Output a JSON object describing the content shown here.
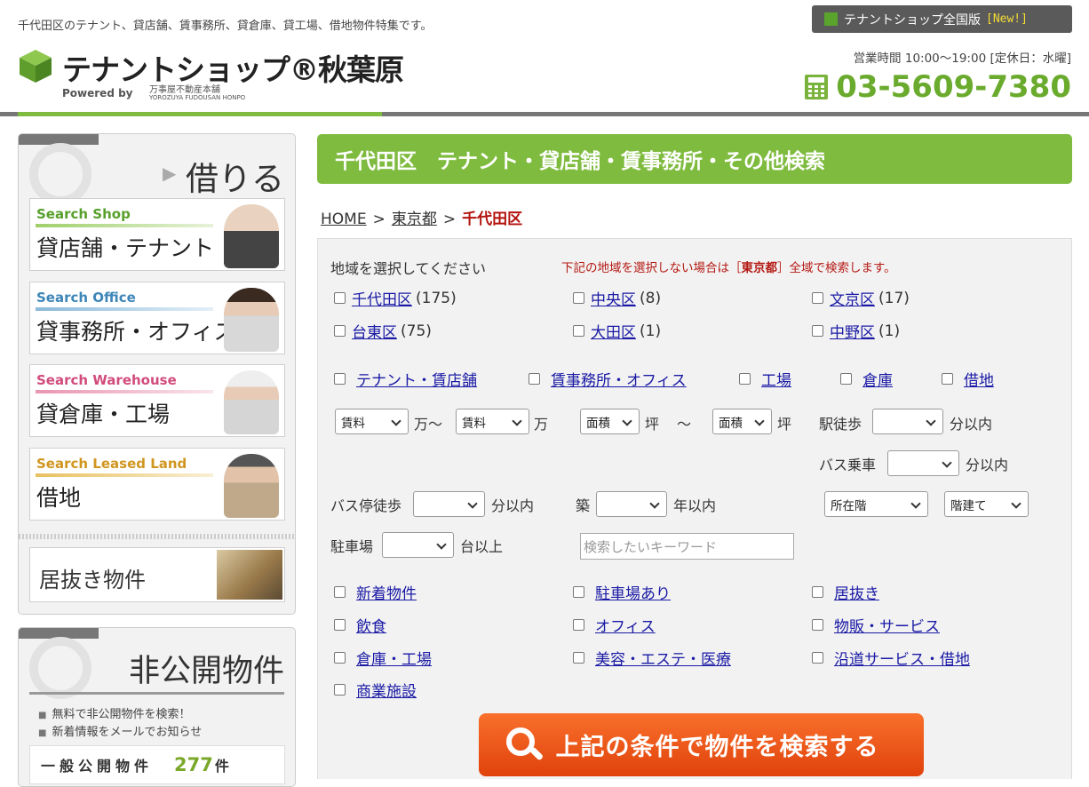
{
  "header": {
    "tagline": "千代田区のテナント、貸店舗、賃事務所、貸倉庫、貸工場、借地物件特集です。",
    "logo_text": "テナントショップ®秋葉原",
    "logo_powered": "Powered by",
    "logo_company": "万事屋不動産本舗",
    "logo_company_roman": "YOROZUYA FUDOUSAN HONPO",
    "national_label": "テナントショップ全国版",
    "national_new": "[New!]",
    "hours": "営業時間 10:00～19:00 [定休日：水曜]",
    "phone": "03-5609-7380"
  },
  "sidebar": {
    "rent_heading": "借りる",
    "categories": [
      {
        "en": "Search Shop",
        "ja": "貸店舗・テナント"
      },
      {
        "en": "Search Office",
        "ja": "貸事務所・オフィス"
      },
      {
        "en": "Search Warehouse",
        "ja": "貸倉庫・工場"
      },
      {
        "en": "Search Leased Land",
        "ja": "借地"
      }
    ],
    "inuki_label": "居抜き物件",
    "hikoukai_heading": "非公開物件",
    "hikoukai_items": [
      "無料で非公開物件を検索！",
      "新着情報をメールでお知らせ"
    ],
    "public_label": "一般公開物件",
    "public_count": "277",
    "public_unit": "件"
  },
  "main": {
    "title": "千代田区　テナント・貸店舗・賃事務所・その他検索",
    "breadcrumb": [
      "HOME",
      "東京都",
      "千代田区"
    ],
    "breadcrumb_sep": ">",
    "area_prompt": "地域を選択してください",
    "notice_pre": "下記の地域を選択しない場合は［",
    "notice_pref": "東京都",
    "notice_post": "］全域で検索します。",
    "areas": [
      {
        "name": "千代田区",
        "count": "(175)"
      },
      {
        "name": "中央区",
        "count": "(8)"
      },
      {
        "name": "文京区",
        "count": "(17)"
      },
      {
        "name": "台東区",
        "count": "(75)"
      },
      {
        "name": "大田区",
        "count": "(1)"
      },
      {
        "name": "中野区",
        "count": "(1)"
      }
    ],
    "types": [
      "テナント・賃店舗",
      "賃事務所・オフィス",
      "工場",
      "倉庫",
      "借地"
    ],
    "rent_from": "賃料",
    "rent_to": "賃料",
    "unit_man": "万",
    "tilde": "～",
    "area_from": "面積",
    "area_to": "面積",
    "unit_tsubo": "坪",
    "station_walk": "駅徒歩",
    "within_min": "分以内",
    "bus_ride": "バス乗車",
    "bus_stop_walk": "バス停徒歩",
    "age": "築",
    "within_years": "年以内",
    "floor_select": "所在階",
    "building_select": "階建て",
    "parking": "駐車場",
    "cars_more": "台以上",
    "keyword_placeholder": "検索したいキーワード",
    "features": [
      "新着物件",
      "駐車場あり",
      "居抜き",
      "飲食",
      "オフィス",
      "物販・サービス",
      "倉庫・工場",
      "美容・エステ・医療",
      "沿道サービス・借地",
      "商業施設"
    ],
    "search_button": "上記の条件で物件を検索する"
  }
}
